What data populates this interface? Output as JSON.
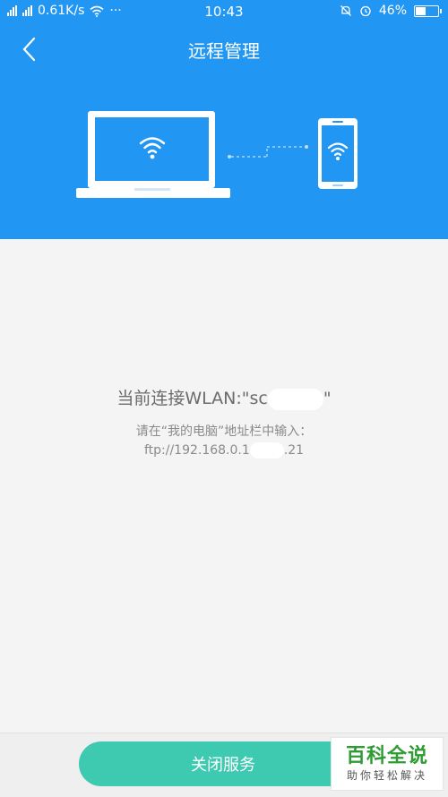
{
  "status_bar": {
    "network_speed": "0.61K/s",
    "more": "···",
    "time": "10:43",
    "battery": "46%",
    "battery_level": 0.46
  },
  "header": {
    "title": "远程管理"
  },
  "connection": {
    "wlan_prefix": "当前连接WLAN:\"sc",
    "wlan_suffix": "\"",
    "instruction": "请在“我的电脑”地址栏中输入：",
    "ftp_prefix": "ftp://192.168.0.1",
    "ftp_suffix": ".21"
  },
  "actions": {
    "close_service": "关闭服务"
  },
  "watermark": {
    "title": "百科全说",
    "subtitle": "助你轻松解决"
  },
  "colors": {
    "header_bg": "#2296f3",
    "button_bg": "#3ec9b1",
    "watermark_green": "#2e9b33"
  }
}
